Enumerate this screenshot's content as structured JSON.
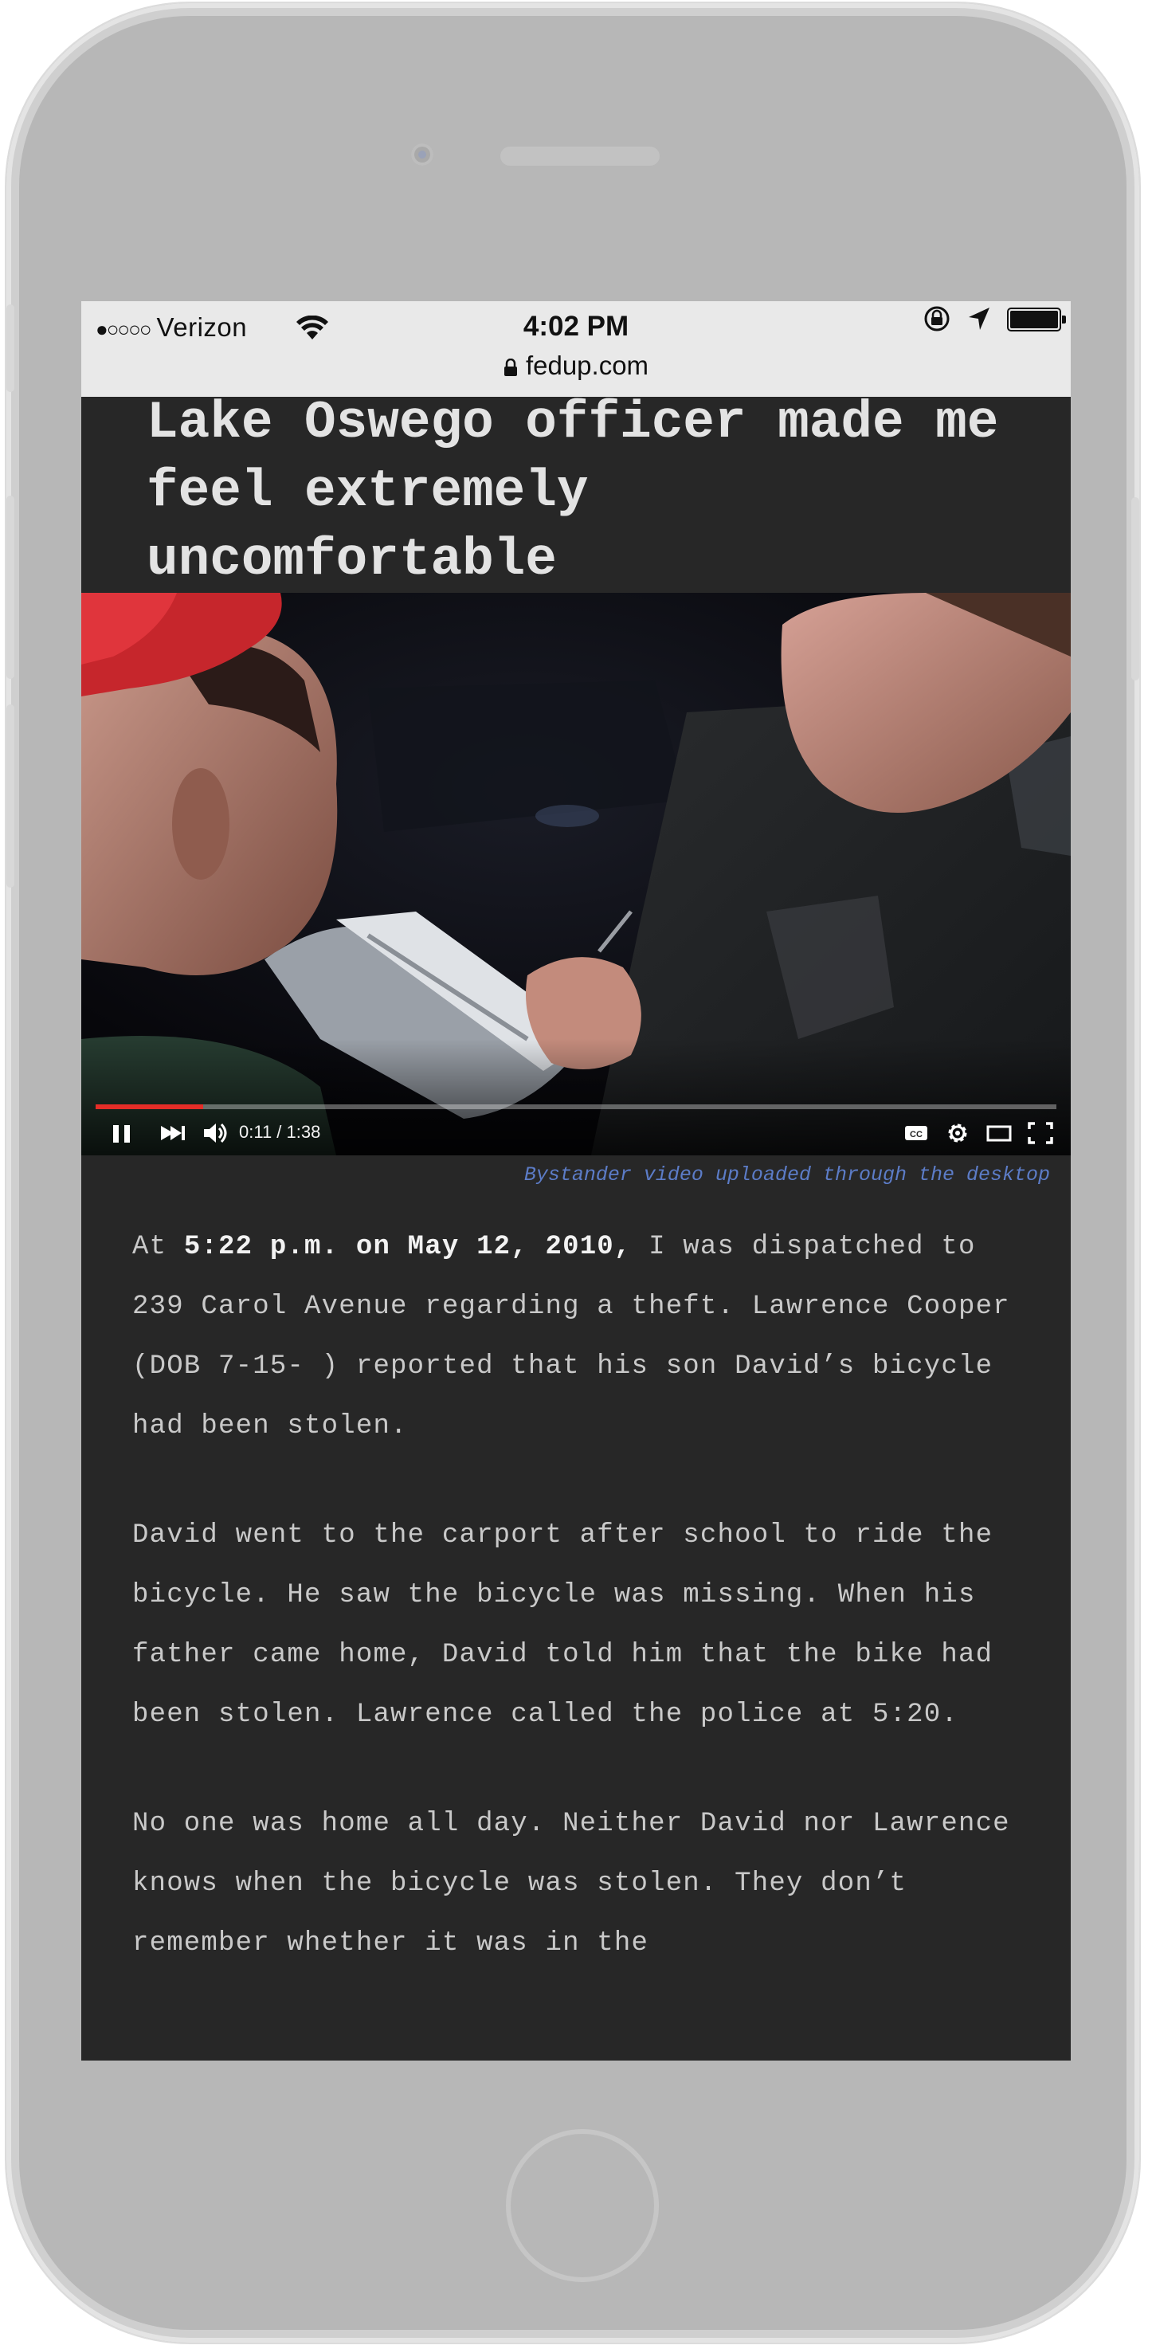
{
  "status_bar": {
    "carrier": "Verizon",
    "signal_dots": "●○○○○",
    "time": "4:02 PM",
    "url": "fedup.com"
  },
  "article": {
    "title": "Lake Oswego officer made me feel extremely uncomfortable",
    "video": {
      "time_readout": "0:11 / 1:38",
      "progress_fraction": 0.112,
      "accent_color": "#e52d27"
    },
    "video_caption": "Bystander video uploaded through the desktop",
    "paragraph1": {
      "lead": "At ",
      "highlight": "5:22 p.m. on May 12, 2010,",
      "rest": " I was dispatched to 239 Carol Avenue regarding a theft. Lawrence Cooper (DOB 7-15- ) reported that his son David’s bicycle had been stolen."
    },
    "paragraph2": "David went to the carport after school to ride the bicycle. He saw the bicycle was missing. When his father came home, David told him that the bike had been stolen. Lawrence called the police at 5:20.",
    "paragraph3": "No one was home all day. Neither David nor Lawrence knows when the bicycle was stolen. They don’t remember whether it was in the"
  },
  "colors": {
    "screen_background": "#272727",
    "caption_link": "#5c7cc7",
    "status_bar": "#e9e9e9"
  },
  "icons": [
    "wifi-icon",
    "lock-icon",
    "rotation-lock-icon",
    "location-arrow-icon",
    "battery-icon",
    "pause-icon",
    "next-icon",
    "volume-icon",
    "cc-icon",
    "settings-icon",
    "theater-mode-icon",
    "fullscreen-icon"
  ]
}
